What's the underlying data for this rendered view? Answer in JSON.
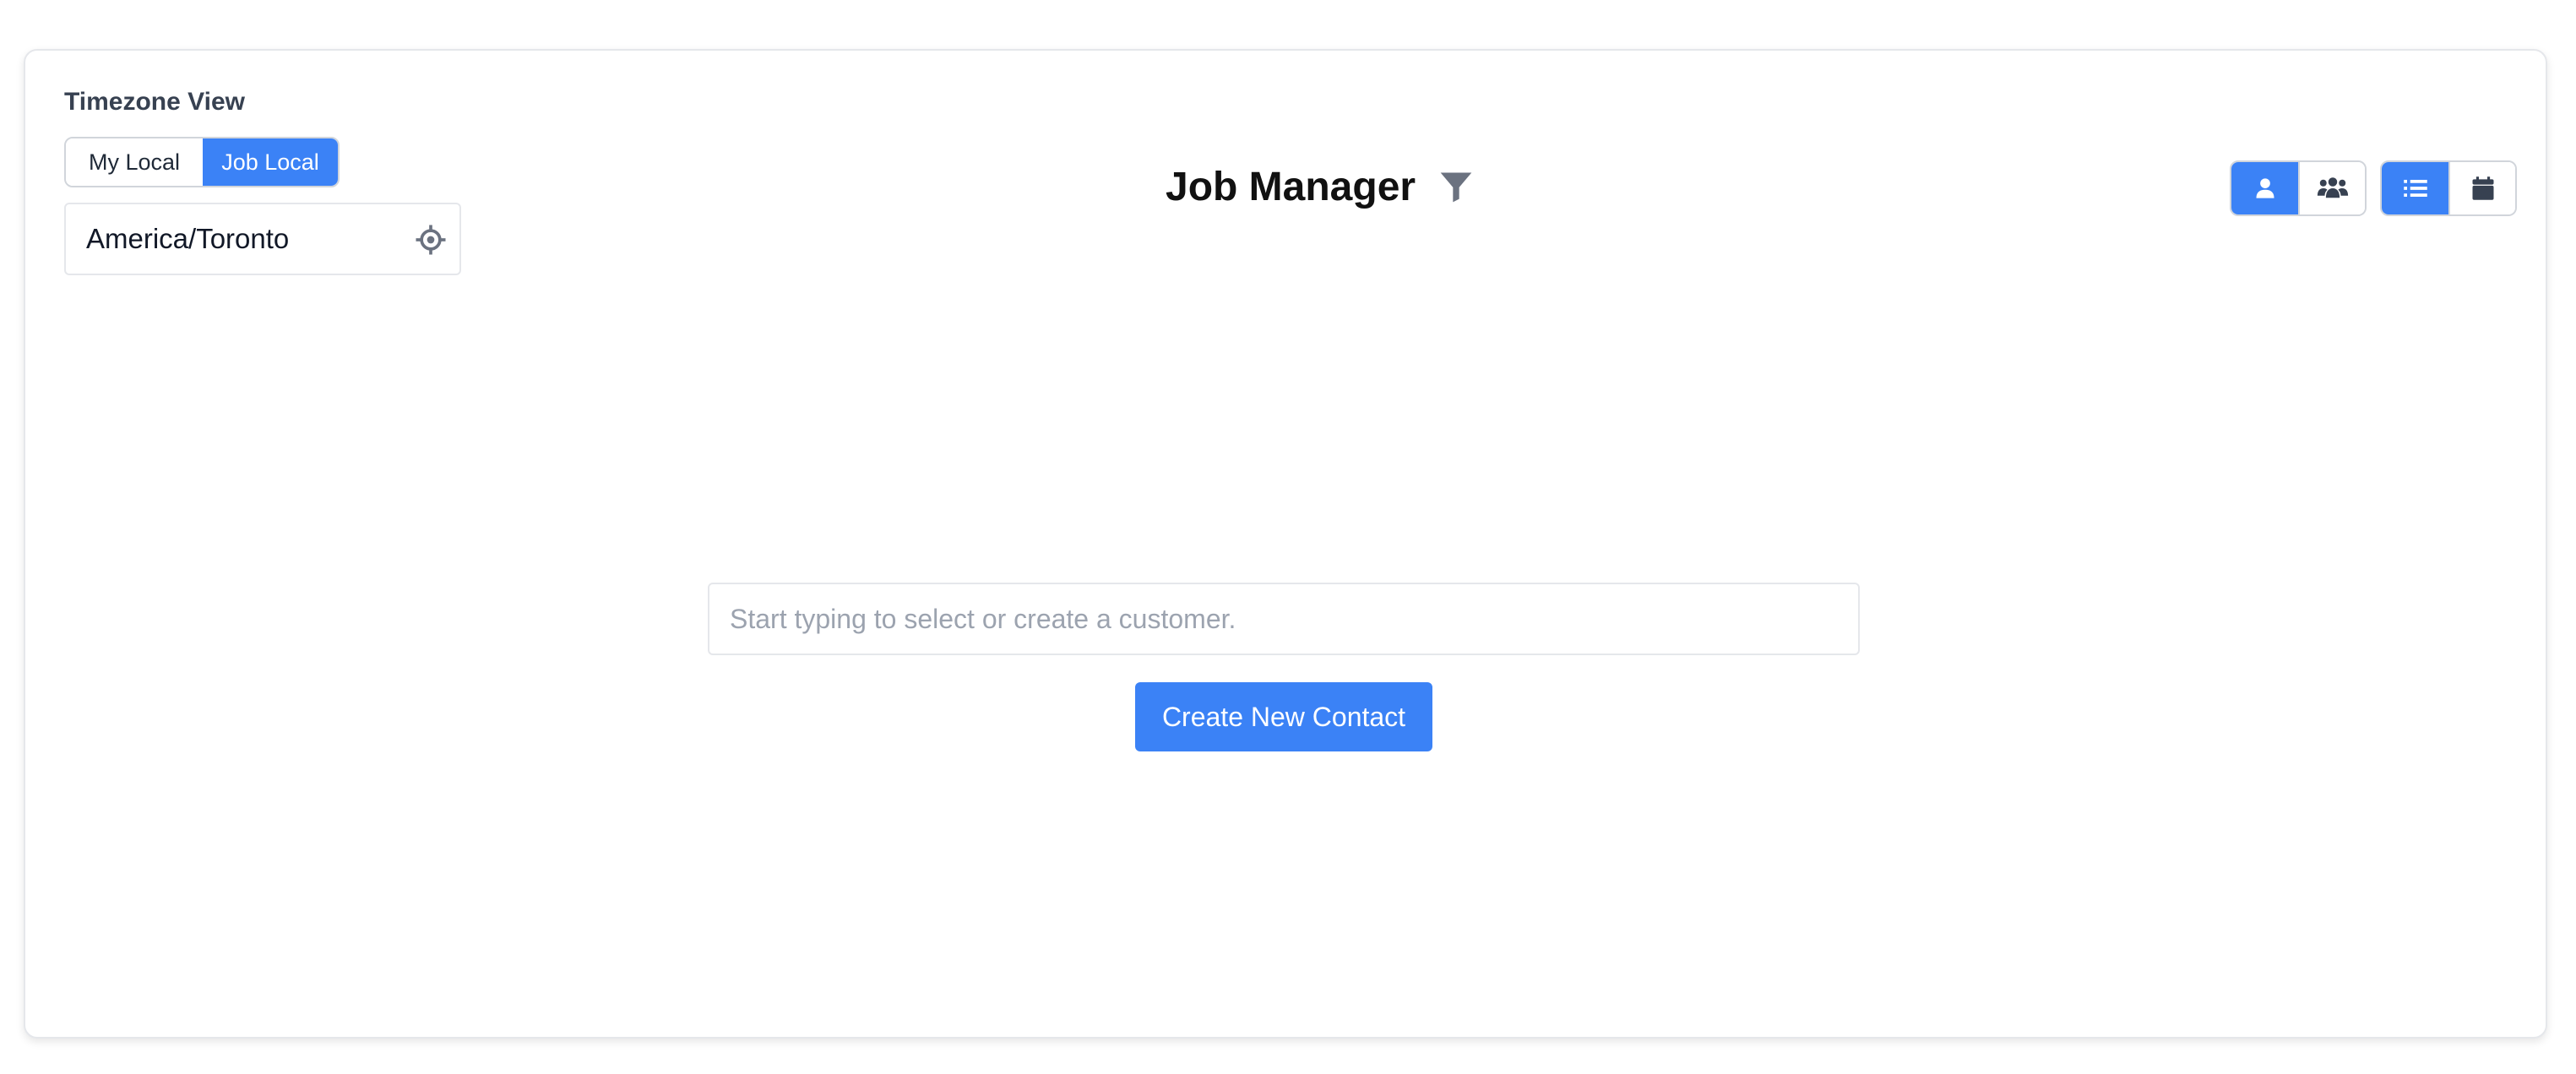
{
  "timezone": {
    "label": "Timezone View",
    "options": [
      "My Local",
      "Job Local"
    ],
    "selected": "Job Local",
    "zone_value": "America/Toronto",
    "locate_icon": "crosshair-icon"
  },
  "header": {
    "title": "Job Manager",
    "filter_icon": "filter-icon"
  },
  "toolbar": {
    "people_group": [
      {
        "icon": "single-user-icon",
        "active": true
      },
      {
        "icon": "multiple-users-icon",
        "active": false
      }
    ],
    "view_group": [
      {
        "icon": "list-icon",
        "active": true
      },
      {
        "icon": "calendar-icon",
        "active": false
      }
    ]
  },
  "customer": {
    "placeholder": "Start typing to select or create a customer.",
    "value": ""
  },
  "actions": {
    "create_contact_label": "Create New Contact"
  },
  "colors": {
    "accent": "#3b82f6",
    "border": "#d1d5db",
    "text_dark": "#111111",
    "placeholder": "#9ca3af",
    "icon_gray": "#6b7280"
  }
}
